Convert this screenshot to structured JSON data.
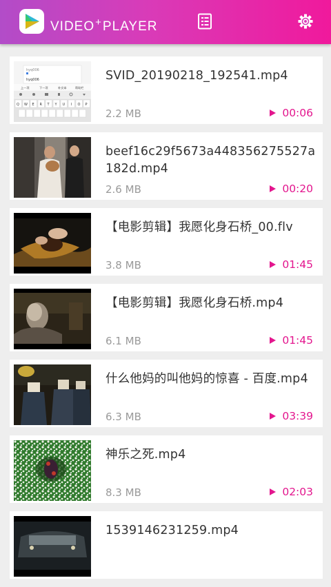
{
  "app": {
    "brand_left": "VIDEO",
    "brand_plus": "+",
    "brand_right": "PLAYER",
    "accent_color": "#e3168e",
    "header_gradient": [
      "#b24cc8",
      "#f0199c"
    ]
  },
  "toolbar": {
    "list_icon": "list-icon",
    "settings_icon": "gear-icon"
  },
  "videos": [
    {
      "name": "SVID_20190218_192541.mp4",
      "size": "2.2 MB",
      "duration": "00:06",
      "thumb": "keyboard-screenshot"
    },
    {
      "name": "beef16c29f5673a448356275527a182d.mp4",
      "size": "2.6 MB",
      "duration": "00:20",
      "thumb": "people-indoors"
    },
    {
      "name": "【电影剪辑】我愿化身石桥_00.flv",
      "size": "3.8 MB",
      "duration": "01:45",
      "thumb": "hands-dark"
    },
    {
      "name": "【电影剪辑】我愿化身石桥.mp4",
      "size": "6.1 MB",
      "duration": "01:45",
      "thumb": "old-man-dark"
    },
    {
      "name": "什么他妈的叫他妈的惊喜 - 百度.mp4",
      "size": "6.3 MB",
      "duration": "03:39",
      "thumb": "masked-figures"
    },
    {
      "name": "神乐之死.mp4",
      "size": "8.3 MB",
      "duration": "02:03",
      "thumb": "flower-field"
    },
    {
      "name": "1539146231259.mp4",
      "size": "",
      "duration": "",
      "thumb": "car-night"
    }
  ],
  "thumb_keyboard": {
    "input_text": "hyq006",
    "suggestion": "hyq006",
    "buttons": [
      "上一项",
      "下一项",
      "补文本",
      "帮助栏"
    ],
    "keys_row1": [
      "Q",
      "W",
      "E",
      "R",
      "T",
      "Y",
      "U",
      "I",
      "O",
      "P"
    ]
  }
}
